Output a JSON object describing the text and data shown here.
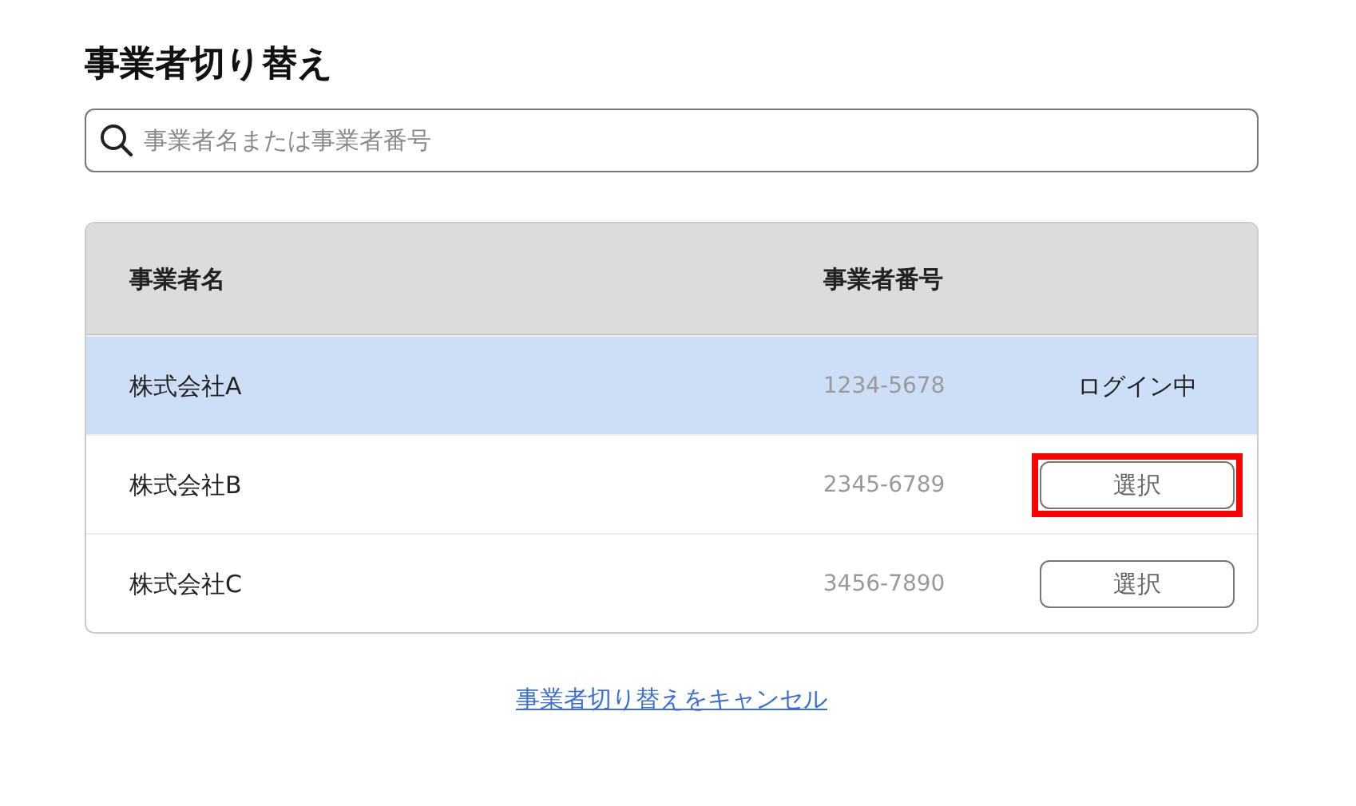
{
  "title": "事業者切り替え",
  "search": {
    "placeholder": "事業者名または事業者番号"
  },
  "table": {
    "columns": [
      "事業者名",
      "事業者番号"
    ],
    "rows": [
      {
        "name": "株式会社A",
        "number": "1234-5678",
        "kind": "status",
        "action": "ログイン中",
        "selected": true
      },
      {
        "name": "株式会社B",
        "number": "2345-6789",
        "kind": "button",
        "action": "選択",
        "selected": false,
        "highlighted": true
      },
      {
        "name": "株式会社C",
        "number": "3456-7890",
        "kind": "button",
        "action": "選択",
        "selected": false,
        "highlighted": false
      }
    ]
  },
  "cancel_link": "事業者切り替えをキャンセル"
}
